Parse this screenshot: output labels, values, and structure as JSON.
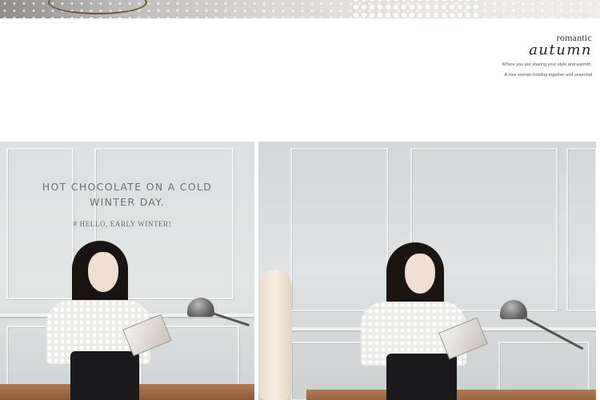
{
  "brand": {
    "small": "romantic",
    "script": "autumn",
    "line1": "Where you are sharing your style and warmth.",
    "line2": "A nice woman holding together and seasonal"
  },
  "left_panel": {
    "caption_line1": "HOT CHOCOLATE ON A COLD",
    "caption_line2": "WINTER DAY.",
    "hashtag": "# HELLO, EARLY WINTER!"
  }
}
